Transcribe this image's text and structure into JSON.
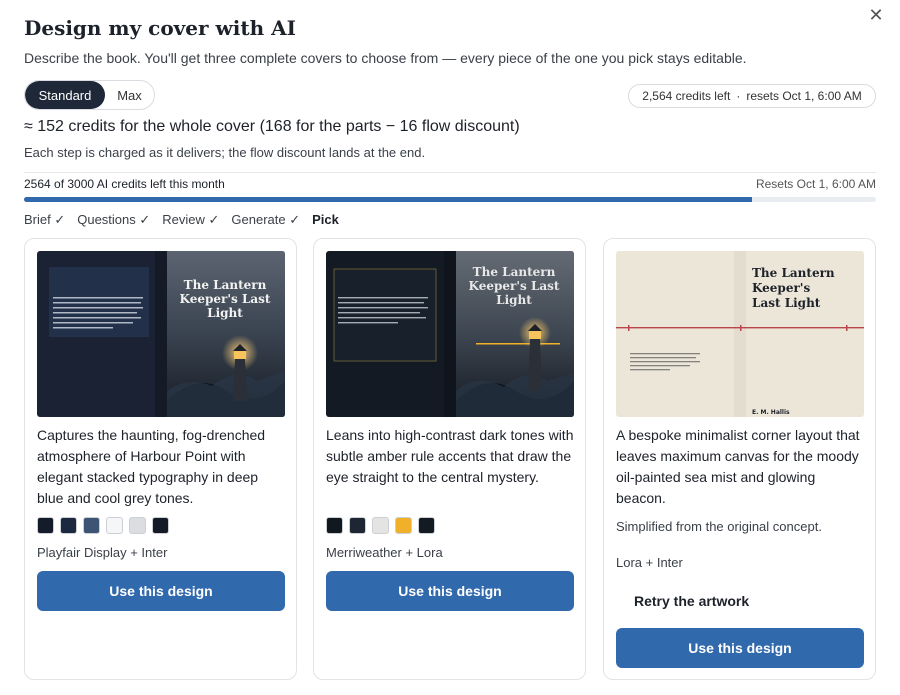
{
  "dialog": {
    "title": "Design my cover with AI",
    "subtitle": "Describe the book. You'll get three complete covers to choose from — every piece of the one you pick stays editable.",
    "close_icon": "close-icon"
  },
  "mode": {
    "options": [
      "Standard",
      "Max"
    ],
    "selected": "Standard"
  },
  "credits_pill": {
    "credits": "2,564 credits left",
    "separator": "·",
    "resets": "resets Oct 1, 6:00 AM"
  },
  "estimate": {
    "headline": "≈ 152 credits for the whole cover (168 for the parts − 16 flow discount)",
    "note": "Each step is charged as it delivers; the flow discount lands at the end."
  },
  "usage": {
    "left_text": "2564 of 3000 AI credits left this month",
    "right_text": "Resets Oct 1, 6:00 AM",
    "used_fraction": 0.8547
  },
  "steps": [
    "Brief ✓",
    "Questions ✓",
    "Review ✓",
    "Generate ✓",
    "Pick"
  ],
  "cards": [
    {
      "cover_title": "The Lantern Keeper's Last Light",
      "description": "Captures the haunting, fog-drenched atmosphere of Harbour Point with elegant stacked typography in deep blue and cool grey tones.",
      "swatches": [
        "#141b2b",
        "#1c2740",
        "#3d5475",
        "#f5f6f8",
        "#dcdde0",
        "#151b26"
      ],
      "fonts": "Playfair Display + Inter",
      "button": "Use this design"
    },
    {
      "cover_title": "The Lantern Keeper's Last Light",
      "description": "Leans into high-contrast dark tones with subtle amber rule accents that draw the eye straight to the central mystery.",
      "swatches": [
        "#121820",
        "#1e2633",
        "#e4e4e2",
        "#f0b02a",
        "#141a22"
      ],
      "fonts": "Merriweather + Lora",
      "button": "Use this design"
    },
    {
      "cover_title": "The Lantern Keeper's Last Light",
      "author": "E. M. Hallis",
      "description": "A bespoke minimalist corner layout that leaves maximum canvas for the moody oil-painted sea mist and glowing beacon.",
      "note": "Simplified from the original concept.",
      "fonts": "Lora + Inter",
      "retry": "Retry the artwork",
      "button": "Use this design"
    }
  ],
  "colors": {
    "accent": "#3169ad",
    "toggle_active": "#1f2838"
  }
}
